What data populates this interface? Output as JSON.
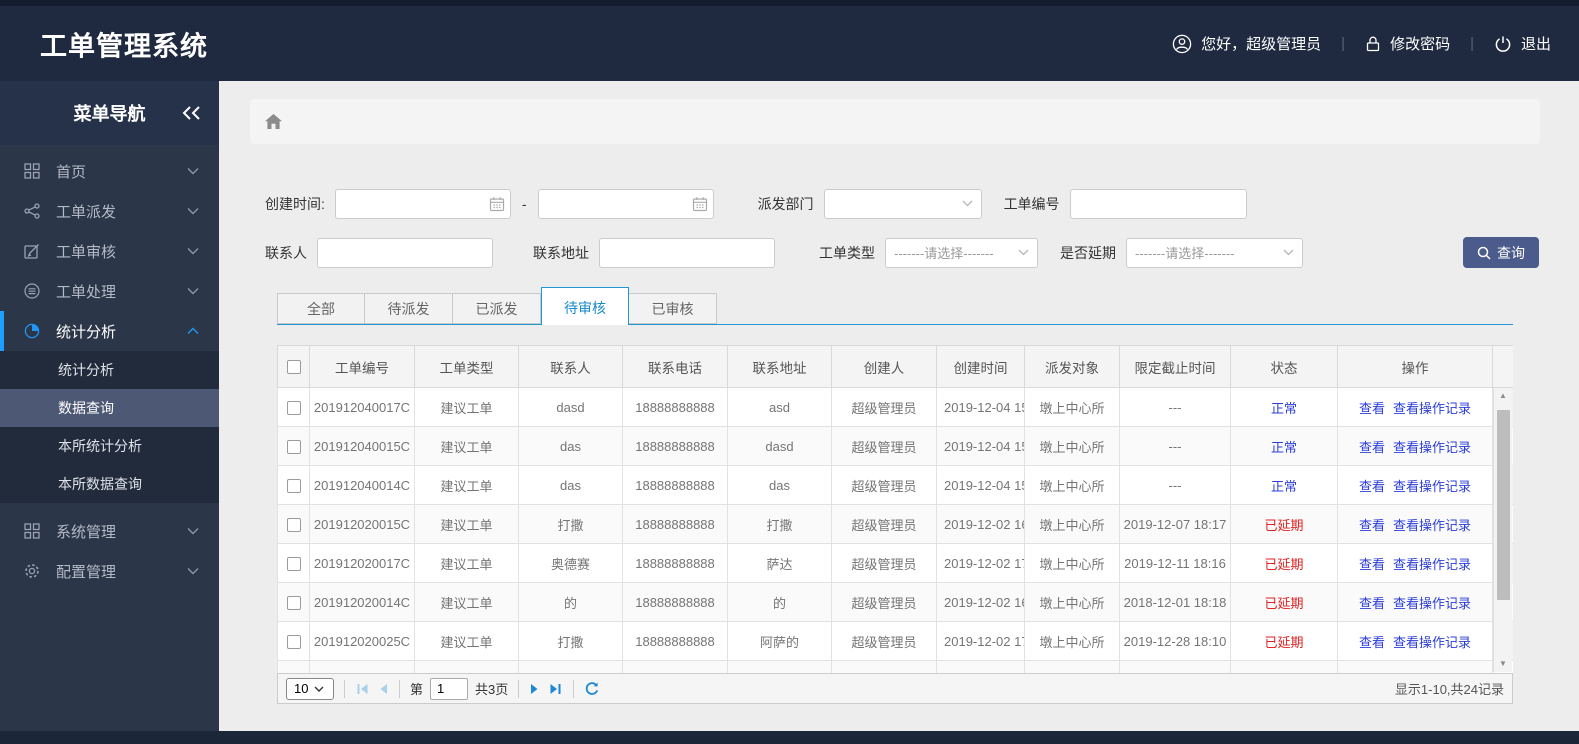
{
  "app": {
    "title": "工单管理系统"
  },
  "topbar": {
    "greeting": "您好，超级管理员",
    "change_password": "修改密码",
    "logout": "退出",
    "divider": "|"
  },
  "sidebar": {
    "title": "菜单导航",
    "items": [
      {
        "label": "首页",
        "icon": "grid-icon"
      },
      {
        "label": "工单派发",
        "icon": "share-icon"
      },
      {
        "label": "工单审核",
        "icon": "edit-icon"
      },
      {
        "label": "工单处理",
        "icon": "process-icon"
      },
      {
        "label": "统计分析",
        "icon": "pie-chart-icon",
        "active": true,
        "expanded": true
      },
      {
        "label": "系统管理",
        "icon": "grid-icon"
      },
      {
        "label": "配置管理",
        "icon": "gear-icon"
      }
    ],
    "submenu": [
      {
        "label": "统计分析",
        "selected": false
      },
      {
        "label": "数据查询",
        "selected": true
      },
      {
        "label": "本所统计分析",
        "selected": false
      },
      {
        "label": "本所数据查询",
        "selected": false
      }
    ]
  },
  "filters": {
    "create_time_label": "创建时间:",
    "date_from_value": "",
    "date_separator": "-",
    "date_to_value": "",
    "dispatch_dept_label": "派发部门",
    "dispatch_dept_value": "",
    "order_no_label": "工单编号",
    "order_no_value": "",
    "contact_label": "联系人",
    "contact_value": "",
    "address_label": "联系地址",
    "address_value": "",
    "order_type_label": "工单类型",
    "order_type_value": "-------请选择-------",
    "delay_label": "是否延期",
    "delay_value": "-------请选择-------",
    "search_button": "查询"
  },
  "tabs": {
    "items": [
      {
        "label": "全部",
        "active": false
      },
      {
        "label": "待派发",
        "active": false
      },
      {
        "label": "已派发",
        "active": false
      },
      {
        "label": "待审核",
        "active": true
      },
      {
        "label": "已审核",
        "active": false
      }
    ]
  },
  "table": {
    "columns": [
      "工单编号",
      "工单类型",
      "联系人",
      "联系电话",
      "联系地址",
      "创建人",
      "创建时间",
      "派发对象",
      "限定截止时间",
      "状态",
      "操作"
    ],
    "actions": {
      "view": "查看",
      "view_log": "查看操作记录"
    },
    "rows": [
      {
        "order_no": "201912040017C",
        "type": "建议工单",
        "contact": "dasd",
        "phone": "18888888888",
        "address": "asd",
        "creator": "超级管理员",
        "create_time": "2019-12-04 15",
        "dispatch_to": "墩上中心所",
        "deadline": "---",
        "status": "正常",
        "status_type": "normal"
      },
      {
        "order_no": "201912040015C",
        "type": "建议工单",
        "contact": "das",
        "phone": "18888888888",
        "address": "dasd",
        "creator": "超级管理员",
        "create_time": "2019-12-04 15",
        "dispatch_to": "墩上中心所",
        "deadline": "---",
        "status": "正常",
        "status_type": "normal"
      },
      {
        "order_no": "201912040014C",
        "type": "建议工单",
        "contact": "das",
        "phone": "18888888888",
        "address": "das",
        "creator": "超级管理员",
        "create_time": "2019-12-04 15",
        "dispatch_to": "墩上中心所",
        "deadline": "---",
        "status": "正常",
        "status_type": "normal"
      },
      {
        "order_no": "201912020015C",
        "type": "建议工单",
        "contact": "打撒",
        "phone": "18888888888",
        "address": "打撒",
        "creator": "超级管理员",
        "create_time": "2019-12-02 16",
        "dispatch_to": "墩上中心所",
        "deadline": "2019-12-07 18:17",
        "status": "已延期",
        "status_type": "delayed"
      },
      {
        "order_no": "201912020017C",
        "type": "建议工单",
        "contact": "奥德赛",
        "phone": "18888888888",
        "address": "萨达",
        "creator": "超级管理员",
        "create_time": "2019-12-02 17",
        "dispatch_to": "墩上中心所",
        "deadline": "2019-12-11 18:16",
        "status": "已延期",
        "status_type": "delayed"
      },
      {
        "order_no": "201912020014C",
        "type": "建议工单",
        "contact": "的",
        "phone": "18888888888",
        "address": "的",
        "creator": "超级管理员",
        "create_time": "2019-12-02 16",
        "dispatch_to": "墩上中心所",
        "deadline": "2018-12-01 18:18",
        "status": "已延期",
        "status_type": "delayed"
      },
      {
        "order_no": "201912020025C",
        "type": "建议工单",
        "contact": "打撒",
        "phone": "18888888888",
        "address": "阿萨的",
        "creator": "超级管理员",
        "create_time": "2019-12-02 17",
        "dispatch_to": "墩上中心所",
        "deadline": "2019-12-28 18:10",
        "status": "已延期",
        "status_type": "delayed"
      }
    ]
  },
  "pagination": {
    "page_size": "10",
    "page_prefix": "第",
    "current_page": "1",
    "total_pages": "共3页",
    "summary": "显示1-10,共24记录"
  },
  "colors": {
    "header_navy": "#1f2a40",
    "sidebar_bg": "#2b3648",
    "submenu_selected": "#4d5875",
    "accent_blue": "#2196f3",
    "tab_active_blue": "#1989c8",
    "search_button": "#4a5b8c",
    "link_blue": "#2b3dd8",
    "status_normal": "#2b3dd8",
    "status_delayed": "#e02020",
    "content_bg": "#ededed"
  }
}
